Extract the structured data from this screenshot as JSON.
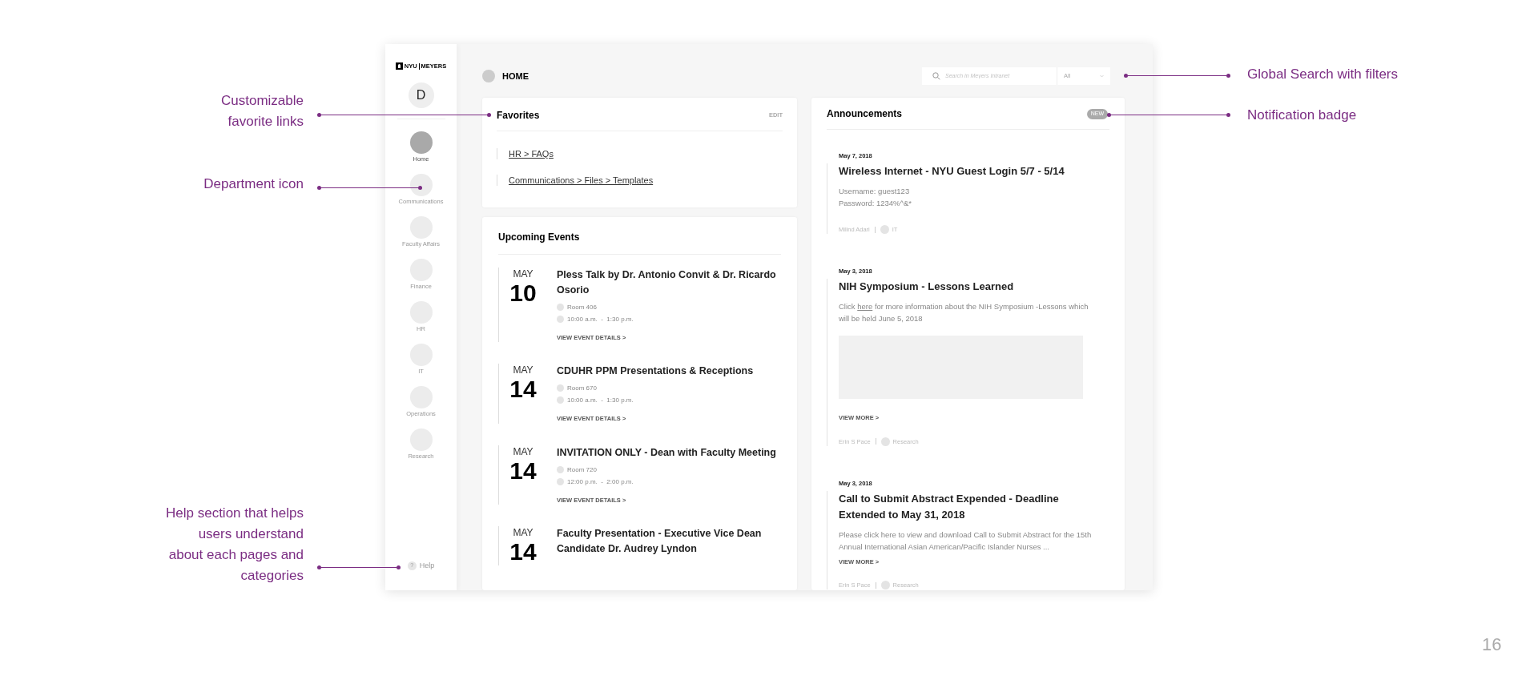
{
  "left_annotations": [
    {
      "lines": [
        "Customizable",
        "favorite links"
      ]
    },
    {
      "lines": [
        "Department icon"
      ]
    },
    {
      "lines": [
        "Help section that helps",
        "users understand",
        "about each pages and",
        "categories"
      ]
    }
  ],
  "right_annotations": [
    {
      "lines": [
        "Global Search with filters"
      ]
    },
    {
      "lines": [
        "Notification badge"
      ]
    }
  ],
  "sidebar": {
    "logo": [
      "NYU",
      "MEYERS"
    ],
    "avatar": "D",
    "items": [
      {
        "label": "Home",
        "selected": true
      },
      {
        "label": "Communications",
        "selected": false
      },
      {
        "label": "Faculty Affairs",
        "selected": false
      },
      {
        "label": "Finance",
        "selected": false
      },
      {
        "label": "HR",
        "selected": false
      },
      {
        "label": "IT",
        "selected": false
      },
      {
        "label": "Operations",
        "selected": false
      },
      {
        "label": "Research",
        "selected": false
      }
    ],
    "help": {
      "icon": "?",
      "label": "Help"
    }
  },
  "header": {
    "title": "HOME",
    "search": {
      "placeholder": "Search in Meyers Intranet"
    },
    "filter": "All"
  },
  "favorites": {
    "title": "Favorites",
    "edit": "EDIT",
    "links": [
      "HR > FAQs",
      "Communications > Files > Templates"
    ]
  },
  "events": {
    "title": "Upcoming Events",
    "items": [
      {
        "month": "MAY",
        "day": "10",
        "title": "Pless Talk by Dr. Antonio Convit & Dr. Ricardo Osorio",
        "room": "Room 406",
        "time": "10:00 a.m.  -  1:30 p.m.",
        "link": "VIEW EVENT DETAILS >"
      },
      {
        "month": "MAY",
        "day": "14",
        "title": "CDUHR PPM Presentations & Receptions",
        "room": "Room 670",
        "time": "10:00 a.m.  -  1:30 p.m.",
        "link": "VIEW EVENT DETAILS >"
      },
      {
        "month": "MAY",
        "day": "14",
        "title": "INVITATION ONLY - Dean with Faculty Meeting",
        "room": "Room 720",
        "time": "12:00 p.m.  -  2:00 p.m.",
        "link": "VIEW EVENT DETAILS >"
      },
      {
        "month": "MAY",
        "day": "14",
        "title": "Faculty Presentation - Executive Vice Dean Candidate Dr. Audrey Lyndon"
      }
    ]
  },
  "announcements": {
    "title": "Announcements",
    "badge": "NEW",
    "items": [
      {
        "date": "May 7, 2018",
        "title": "Wireless Internet - NYU Guest Login 5/7 - 5/14",
        "body": [
          {
            "text": "Username: guest123"
          },
          {
            "text": "Password: 1234%^&*"
          }
        ],
        "image_placeholder": false,
        "author": "Milind Adari",
        "department": "IT"
      },
      {
        "date": "May 3, 2018",
        "title": "NIH Symposium - Lessons Learned",
        "body": [
          {
            "before": "Click ",
            "link": "here",
            "after": " for more information about the NIH Symposium -Lessons which will be held June 5, 2018"
          }
        ],
        "image_placeholder": true,
        "more": "VIEW MORE >",
        "author": "Erin S Pace",
        "department": "Research"
      },
      {
        "date": "May 3, 2018",
        "title": "Call to Submit Abstract Expended - Deadline Extended to May 31, 2018",
        "body": [
          {
            "text": "Please click here to view and download Call to Submit Abstract for the 15th Annual International Asian American/Pacific Islander Nurses ..."
          }
        ],
        "image_placeholder": false,
        "more": "VIEW MORE >",
        "author": "Erin S Pace",
        "department": "Research"
      }
    ]
  },
  "page_number": "16"
}
